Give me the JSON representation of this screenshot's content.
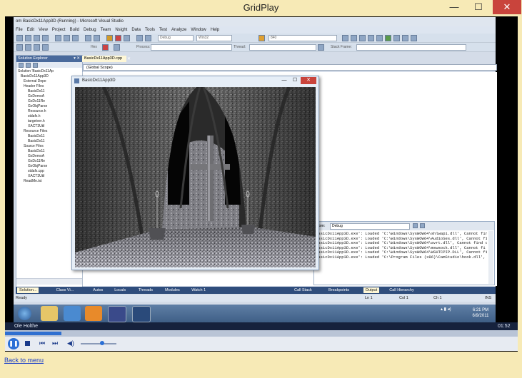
{
  "outer_window": {
    "title": "GridPlay",
    "minimize": "—",
    "maximize": "☐",
    "close": "✕"
  },
  "vs": {
    "title": "BasicDx11App3D (Running) - Microsoft Visual Studio",
    "title_prefix": "om",
    "menu": [
      "File",
      "Edit",
      "View",
      "Project",
      "Build",
      "Debug",
      "Team",
      "Nsight",
      "Data",
      "Tools",
      "Test",
      "Analyze",
      "Window",
      "Help"
    ],
    "toolbar": {
      "config": "Debug",
      "platform": "Win32",
      "field": "840",
      "hex": "Hex",
      "process": "Process:",
      "thread": "Thread:",
      "stack_frame": "Stack Frame:"
    },
    "solution_explorer": {
      "title": "Solution Explorer",
      "items": [
        "Solution 'BasicDx11Ap",
        "BasicDx11App3D",
        "External Depe",
        "Header Files",
        "BasicDx11",
        "GxDemoA",
        "GxDx11Re",
        "GxObjParse",
        "Resource.h",
        "stdafx.h",
        "targetver.h",
        "XACT3Util",
        "Resource Files",
        "BasicDx11",
        "BasicDx11",
        "Source Files",
        "BasicDx11",
        "GxDemoA",
        "GxDx11Re",
        "GxObjParse",
        "stdafx.cpp",
        "XACT3Util",
        "ReadMe.txt"
      ]
    },
    "editor": {
      "tab": "BasicDx11App3D.cpp",
      "scope": "(Global Scope)"
    },
    "output": {
      "from_label": "from:",
      "source": "Debug",
      "lines": [
        "BasicDx11App3D.exe': Loaded 'C:\\Windows\\SysWOW64\\shlwapi.dll', Cannot fir",
        "BasicDx11App3D.exe': Loaded 'C:\\Windows\\SysWOW64\\AudioSes.dll', Cannot fi",
        "BasicDx11App3D.exe': Loaded 'C:\\Windows\\SysWOW64\\avrt.dll', Cannot find c",
        "BasicDx11App3D.exe': Loaded 'C:\\Windows\\SysWOW64\\mswsock.dll', Cannot fi",
        "BasicDx11App3D.exe': Loaded 'C:\\Windows\\SysWOW64\\WSHTCPIP.DLL', Cannot fi",
        "BasicDx11App3D.exe': Loaded 'C:\\Program Files (x86)\\CamStudio\\hook.dll',"
      ]
    },
    "bottom_tabs_left": [
      "Solution...",
      "Class Vi...",
      "Autos",
      "Locals",
      "Threads",
      "Modules",
      "Watch 1"
    ],
    "bottom_tabs_right": [
      "Call Stack",
      "Breakpoints",
      "Output",
      "Call Hierarchy"
    ],
    "status": {
      "ready": "Ready",
      "ln": "Ln 1",
      "col": "Col 1",
      "ch": "Ch 1",
      "ins": "INS"
    }
  },
  "g3_window": {
    "title": "BasicDx11App3D"
  },
  "taskbar": {
    "time": "6:21 PM",
    "date": "6/9/2011"
  },
  "player": {
    "name": "Ole Holthe",
    "time": "01:52",
    "seek_fraction": 0.11,
    "volume_fraction": 0.6,
    "back_link": "Back to menu"
  },
  "colors": {
    "frame": "#f7eab6",
    "vs_blue": "#2f4d7c",
    "accent": "#1a3ec8"
  }
}
